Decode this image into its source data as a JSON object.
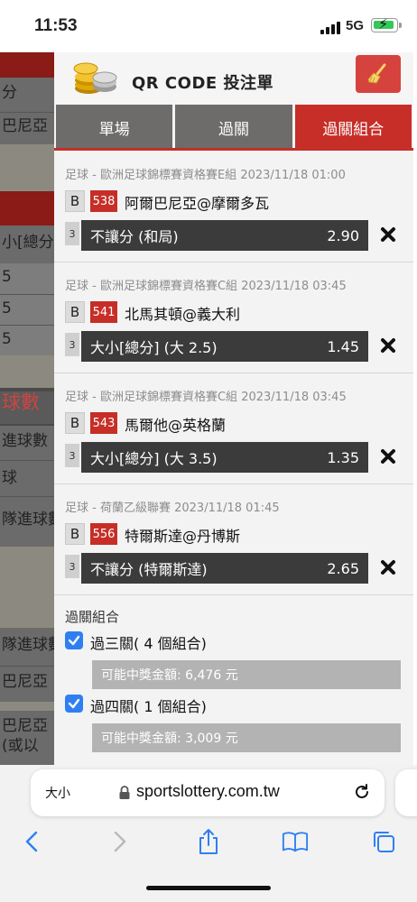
{
  "status_bar": {
    "time": "11:53",
    "network": "5G"
  },
  "background_page": {
    "rows": [
      "分",
      "巴尼亞",
      "小[總分]",
      "5",
      "5",
      "5",
      "球數",
      "進球數",
      "球",
      "隊進球數",
      "隊進球數",
      "巴尼亞",
      "巴尼亞",
      "(或以"
    ]
  },
  "modal": {
    "title": "QR CODE 投注單",
    "tabs": [
      "單場",
      "過關",
      "過關組合"
    ],
    "active_tab": "過關組合",
    "bets": [
      {
        "league": "足球 - 歐洲足球錦標賽資格賽E組",
        "datetime": "2023/11/18 01:00",
        "badge": "B",
        "number": "538",
        "teams": "阿爾巴尼亞@摩爾多瓦",
        "index": "3",
        "selection": "不讓分 (和局)",
        "odds": "2.90"
      },
      {
        "league": "足球 - 歐洲足球錦標賽資格賽C組",
        "datetime": "2023/11/18 03:45",
        "badge": "B",
        "number": "541",
        "teams": "北馬其頓@義大利",
        "index": "3",
        "selection": "大小[總分] (大 2.5)",
        "odds": "1.45"
      },
      {
        "league": "足球 - 歐洲足球錦標賽資格賽C組",
        "datetime": "2023/11/18 03:45",
        "badge": "B",
        "number": "543",
        "teams": "馬爾他@英格蘭",
        "index": "3",
        "selection": "大小[總分] (大 3.5)",
        "odds": "1.35"
      },
      {
        "league": "足球 - 荷蘭乙級聯賽",
        "datetime": "2023/11/18 01:45",
        "badge": "B",
        "number": "556",
        "teams": "特爾斯達@丹博斯",
        "index": "3",
        "selection": "不讓分 (特爾斯達)",
        "odds": "2.65"
      }
    ],
    "combo": {
      "heading": "過關組合",
      "options": [
        {
          "label": "過三關( 4 個組合)",
          "checked": true,
          "prize": "可能中獎金額: 6,476 元"
        },
        {
          "label": "過四關( 1 個組合)",
          "checked": true,
          "prize": "可能中獎金額: 3,009 元"
        }
      ]
    }
  },
  "browser": {
    "text_size_label": "大小",
    "url": "sportslottery.com.tw"
  },
  "colors": {
    "accent_red": "#c62e27",
    "tab_gray": "#6e6b6b",
    "checkbox_blue": "#2f7ff2",
    "odds_dark": "#3b3b3b"
  }
}
